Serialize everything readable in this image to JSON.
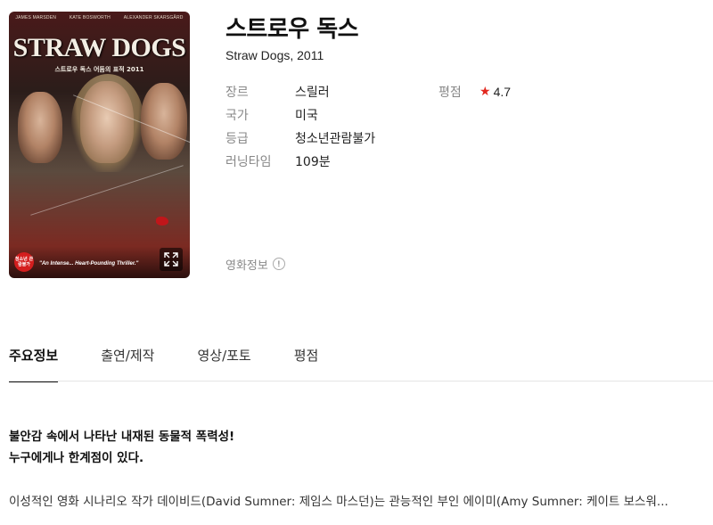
{
  "poster": {
    "credits": [
      "JAMES MARSDEN",
      "KATE BOSWORTH",
      "ALEXANDER SKARSGÅRD"
    ],
    "logo_text": "STRAW DOGS",
    "logo_subtext": "스트로우 독스 어둠의 표적 2011",
    "rating_badge": "청소년 관람불가",
    "tagline": "\"An Intense... Heart-Pounding Thriller.\"",
    "expand_icon": "expand-icon"
  },
  "movie": {
    "title": "스트로우 독스",
    "subtitle": "Straw Dogs, 2011"
  },
  "info": [
    {
      "label": "장르",
      "value": "스릴러"
    },
    {
      "label": "국가",
      "value": "미국"
    },
    {
      "label": "등급",
      "value": "청소년관람불가"
    },
    {
      "label": "러닝타임",
      "value": "109분"
    }
  ],
  "rating": {
    "label": "평점",
    "star": "★",
    "value": "4.7",
    "star_color": "#e2271e"
  },
  "movie_info_link": {
    "label": "영화정보",
    "icon_text": "!"
  },
  "tabs": [
    {
      "label": "주요정보",
      "active": true
    },
    {
      "label": "출연/제작",
      "active": false
    },
    {
      "label": "영상/포토",
      "active": false
    },
    {
      "label": "평점",
      "active": false
    }
  ],
  "synopsis": {
    "headline_line1": "불안감 속에서 나타난 내재된 동물적 폭력성!",
    "headline_line2": "누구에게나 한계점이 있다.",
    "body": "이성적인 영화 시나리오 작가 데이비드(David Sumner: 제임스 마스던)는 관능적인 부인 에이미(Amy Sumner: 케이트 보스워..."
  }
}
